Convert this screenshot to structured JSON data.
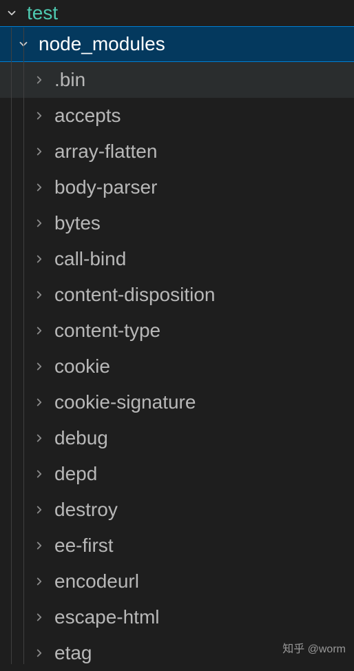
{
  "root": {
    "name": "test",
    "expanded": true
  },
  "node_modules": {
    "name": "node_modules",
    "expanded": true,
    "selected": true
  },
  "folders": [
    {
      "name": ".bin",
      "hovered": true
    },
    {
      "name": "accepts",
      "hovered": false
    },
    {
      "name": "array-flatten",
      "hovered": false
    },
    {
      "name": "body-parser",
      "hovered": false
    },
    {
      "name": "bytes",
      "hovered": false
    },
    {
      "name": "call-bind",
      "hovered": false
    },
    {
      "name": "content-disposition",
      "hovered": false
    },
    {
      "name": "content-type",
      "hovered": false
    },
    {
      "name": "cookie",
      "hovered": false
    },
    {
      "name": "cookie-signature",
      "hovered": false
    },
    {
      "name": "debug",
      "hovered": false
    },
    {
      "name": "depd",
      "hovered": false
    },
    {
      "name": "destroy",
      "hovered": false
    },
    {
      "name": "ee-first",
      "hovered": false
    },
    {
      "name": "encodeurl",
      "hovered": false
    },
    {
      "name": "escape-html",
      "hovered": false
    },
    {
      "name": "etag",
      "hovered": false
    }
  ],
  "watermark": "知乎 @worm"
}
